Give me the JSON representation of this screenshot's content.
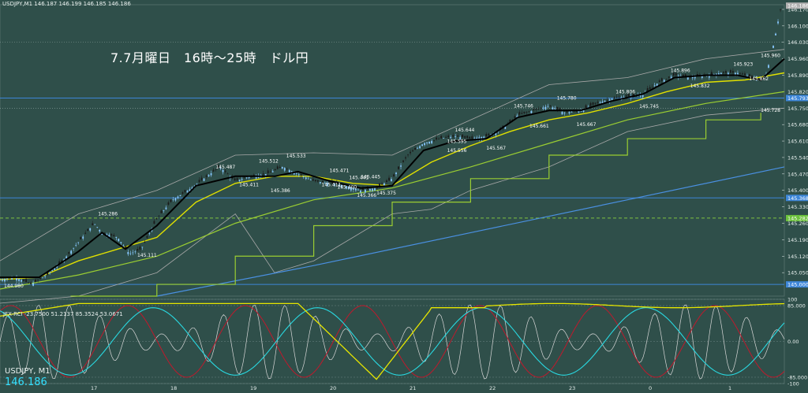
{
  "colors": {
    "background": "#2f4f4a",
    "grid": "#4f6b67",
    "text": "#e8f0ee",
    "ema_fast": "#000000",
    "ema_mid": "#e0e000",
    "ema_slow": "#9acd32",
    "bb": "#a9a9a9",
    "step_line": "#9acd32",
    "long_ma": "#4a90e2",
    "candle_up": "#88c8ff",
    "candle_down": "#1a1a1a",
    "hline_blue": "#3d86d8",
    "hline_green": "#7fc241",
    "osc_cyan": "#29d8e0",
    "osc_red": "#c0192c",
    "osc_yellow": "#e6e600",
    "osc_white": "#d8d8d8"
  },
  "header": {
    "text": "USDJPY,M1  146.187 146.199 146.185 146.186"
  },
  "annotation": {
    "text": "7.7月曜日　16時～25時　ドル円"
  },
  "subwindow": {
    "title": "JFX-RCI -23.7500 51.2137 85.3524 53.0671",
    "symbol": "USDJPY, M1",
    "price": "146.186"
  },
  "chart_data": [
    {
      "type": "candlestick",
      "title": "USDJPY,M1",
      "ylim": [
        144.95,
        146.19
      ],
      "yticks": [
        "146.170",
        "146.100",
        "146.030",
        "145.960",
        "145.890",
        "145.820",
        "145.750",
        "145.680",
        "145.610",
        "145.540",
        "145.470",
        "145.400",
        "145.330",
        "145.260",
        "145.190",
        "145.120",
        "145.050"
      ],
      "xticks": [
        "17",
        "18",
        "19",
        "20",
        "21",
        "22",
        "23",
        "0",
        "1"
      ],
      "price_tags": [
        "146.186",
        "145.793",
        "145.368",
        "145.282",
        "145.000"
      ],
      "price_annotations": [
        {
          "x": 0.005,
          "value": "144.980"
        },
        {
          "x": 0.125,
          "value": "145.286"
        },
        {
          "x": 0.175,
          "value": "145.111"
        },
        {
          "x": 0.275,
          "value": "145.487"
        },
        {
          "x": 0.305,
          "value": "145.411"
        },
        {
          "x": 0.33,
          "value": "145.512"
        },
        {
          "x": 0.345,
          "value": "145.386"
        },
        {
          "x": 0.365,
          "value": "145.533"
        },
        {
          "x": 0.42,
          "value": "145.471"
        },
        {
          "x": 0.41,
          "value": "145.411"
        },
        {
          "x": 0.43,
          "value": "145.400"
        },
        {
          "x": 0.445,
          "value": "145.441"
        },
        {
          "x": 0.46,
          "value": "145.445"
        },
        {
          "x": 0.455,
          "value": "145.366"
        },
        {
          "x": 0.48,
          "value": "145.375"
        },
        {
          "x": 0.58,
          "value": "145.644"
        },
        {
          "x": 0.57,
          "value": "145.595"
        },
        {
          "x": 0.57,
          "value": "145.556"
        },
        {
          "x": 0.62,
          "value": "145.567"
        },
        {
          "x": 0.655,
          "value": "145.746"
        },
        {
          "x": 0.675,
          "value": "145.661"
        },
        {
          "x": 0.71,
          "value": "145.780"
        },
        {
          "x": 0.735,
          "value": "145.667"
        },
        {
          "x": 0.785,
          "value": "145.806"
        },
        {
          "x": 0.815,
          "value": "145.745"
        },
        {
          "x": 0.855,
          "value": "145.896"
        },
        {
          "x": 0.88,
          "value": "145.832"
        },
        {
          "x": 0.935,
          "value": "145.923"
        },
        {
          "x": 0.955,
          "value": "145.862"
        },
        {
          "x": 0.97,
          "value": "145.960"
        },
        {
          "x": 0.97,
          "value": "145.728"
        }
      ],
      "close_path": [
        [
          0.0,
          145.02
        ],
        [
          0.02,
          145.03
        ],
        [
          0.04,
          145.0
        ],
        [
          0.06,
          145.04
        ],
        [
          0.08,
          145.1
        ],
        [
          0.1,
          145.18
        ],
        [
          0.12,
          145.26
        ],
        [
          0.13,
          145.22
        ],
        [
          0.15,
          145.2
        ],
        [
          0.165,
          145.13
        ],
        [
          0.18,
          145.15
        ],
        [
          0.2,
          145.28
        ],
        [
          0.22,
          145.36
        ],
        [
          0.24,
          145.4
        ],
        [
          0.26,
          145.45
        ],
        [
          0.28,
          145.5
        ],
        [
          0.3,
          145.44
        ],
        [
          0.32,
          145.46
        ],
        [
          0.34,
          145.47
        ],
        [
          0.36,
          145.5
        ],
        [
          0.38,
          145.47
        ],
        [
          0.4,
          145.44
        ],
        [
          0.42,
          145.43
        ],
        [
          0.44,
          145.42
        ],
        [
          0.46,
          145.4
        ],
        [
          0.48,
          145.41
        ],
        [
          0.5,
          145.45
        ],
        [
          0.52,
          145.55
        ],
        [
          0.54,
          145.6
        ],
        [
          0.56,
          145.62
        ],
        [
          0.58,
          145.63
        ],
        [
          0.6,
          145.62
        ],
        [
          0.62,
          145.63
        ],
        [
          0.64,
          145.66
        ],
        [
          0.66,
          145.72
        ],
        [
          0.68,
          145.74
        ],
        [
          0.7,
          145.76
        ],
        [
          0.72,
          145.73
        ],
        [
          0.74,
          145.74
        ],
        [
          0.76,
          145.77
        ],
        [
          0.78,
          145.79
        ],
        [
          0.8,
          145.8
        ],
        [
          0.82,
          145.81
        ],
        [
          0.84,
          145.86
        ],
        [
          0.86,
          145.89
        ],
        [
          0.88,
          145.88
        ],
        [
          0.9,
          145.89
        ],
        [
          0.92,
          145.9
        ],
        [
          0.94,
          145.9
        ],
        [
          0.96,
          145.88
        ],
        [
          0.975,
          145.87
        ],
        [
          0.985,
          146.0
        ],
        [
          0.995,
          146.17
        ]
      ],
      "ema_fast": [
        [
          0.0,
          145.03
        ],
        [
          0.05,
          145.03
        ],
        [
          0.1,
          145.14
        ],
        [
          0.13,
          145.22
        ],
        [
          0.16,
          145.15
        ],
        [
          0.2,
          145.25
        ],
        [
          0.25,
          145.42
        ],
        [
          0.3,
          145.46
        ],
        [
          0.35,
          145.46
        ],
        [
          0.38,
          145.48
        ],
        [
          0.42,
          145.44
        ],
        [
          0.46,
          145.41
        ],
        [
          0.5,
          145.42
        ],
        [
          0.54,
          145.57
        ],
        [
          0.58,
          145.61
        ],
        [
          0.62,
          145.62
        ],
        [
          0.66,
          145.71
        ],
        [
          0.7,
          145.74
        ],
        [
          0.74,
          145.74
        ],
        [
          0.78,
          145.78
        ],
        [
          0.82,
          145.81
        ],
        [
          0.86,
          145.88
        ],
        [
          0.9,
          145.89
        ],
        [
          0.94,
          145.89
        ],
        [
          0.97,
          145.87
        ],
        [
          1.0,
          145.96
        ]
      ],
      "ema_mid": [
        [
          0.0,
          145.02
        ],
        [
          0.05,
          145.03
        ],
        [
          0.1,
          145.1
        ],
        [
          0.15,
          145.15
        ],
        [
          0.2,
          145.2
        ],
        [
          0.25,
          145.35
        ],
        [
          0.3,
          145.43
        ],
        [
          0.35,
          145.46
        ],
        [
          0.4,
          145.46
        ],
        [
          0.45,
          145.43
        ],
        [
          0.5,
          145.42
        ],
        [
          0.55,
          145.52
        ],
        [
          0.6,
          145.59
        ],
        [
          0.65,
          145.65
        ],
        [
          0.7,
          145.7
        ],
        [
          0.75,
          145.73
        ],
        [
          0.8,
          145.77
        ],
        [
          0.85,
          145.82
        ],
        [
          0.9,
          145.86
        ],
        [
          0.95,
          145.87
        ],
        [
          1.0,
          145.9
        ]
      ],
      "ema_slow": [
        [
          0.0,
          144.98
        ],
        [
          0.1,
          145.04
        ],
        [
          0.2,
          145.12
        ],
        [
          0.3,
          145.26
        ],
        [
          0.4,
          145.36
        ],
        [
          0.5,
          145.41
        ],
        [
          0.6,
          145.5
        ],
        [
          0.7,
          145.6
        ],
        [
          0.8,
          145.7
        ],
        [
          0.9,
          145.77
        ],
        [
          1.0,
          145.82
        ]
      ],
      "bb_upper": [
        [
          0.0,
          145.1
        ],
        [
          0.1,
          145.3
        ],
        [
          0.2,
          145.4
        ],
        [
          0.3,
          145.55
        ],
        [
          0.4,
          145.56
        ],
        [
          0.5,
          145.55
        ],
        [
          0.6,
          145.7
        ],
        [
          0.7,
          145.85
        ],
        [
          0.8,
          145.88
        ],
        [
          0.9,
          145.96
        ],
        [
          1.0,
          146.0
        ]
      ],
      "bb_lower": [
        [
          0.0,
          144.92
        ],
        [
          0.1,
          144.95
        ],
        [
          0.2,
          145.05
        ],
        [
          0.3,
          145.3
        ],
        [
          0.35,
          145.05
        ],
        [
          0.4,
          145.1
        ],
        [
          0.5,
          145.3
        ],
        [
          0.55,
          145.32
        ],
        [
          0.6,
          145.4
        ],
        [
          0.7,
          145.5
        ],
        [
          0.8,
          145.65
        ],
        [
          0.9,
          145.72
        ],
        [
          1.0,
          145.75
        ]
      ],
      "step_line": [
        [
          0.09,
          144.95
        ],
        [
          0.2,
          145.0
        ],
        [
          0.3,
          145.12
        ],
        [
          0.4,
          145.25
        ],
        [
          0.5,
          145.35
        ],
        [
          0.6,
          145.45
        ],
        [
          0.7,
          145.55
        ],
        [
          0.8,
          145.62
        ],
        [
          0.9,
          145.7
        ],
        [
          0.97,
          145.73
        ]
      ],
      "long_ma": [
        [
          0.2,
          144.95
        ],
        [
          0.4,
          145.08
        ],
        [
          0.6,
          145.22
        ],
        [
          0.8,
          145.36
        ],
        [
          1.0,
          145.5
        ]
      ],
      "hlines": [
        {
          "value": 145.793,
          "color": "hline_blue",
          "dashed": false
        },
        {
          "value": 145.368,
          "color": "hline_blue",
          "dashed": false
        },
        {
          "value": 145.282,
          "color": "hline_green",
          "dashed": true
        },
        {
          "value": 145.0,
          "color": "hline_blue",
          "dashed": false
        }
      ]
    },
    {
      "type": "line",
      "title": "JFX-RCI",
      "ylim": [
        -100,
        100
      ],
      "yticks": [
        "100",
        "85.000",
        "0.00",
        "-85.000",
        "-100"
      ],
      "series": [
        {
          "name": "rci_short",
          "color": "osc_white"
        },
        {
          "name": "rci_mid",
          "color": "osc_red"
        },
        {
          "name": "rci_cyan",
          "color": "osc_cyan"
        },
        {
          "name": "rci_long",
          "color": "osc_yellow"
        }
      ]
    }
  ]
}
